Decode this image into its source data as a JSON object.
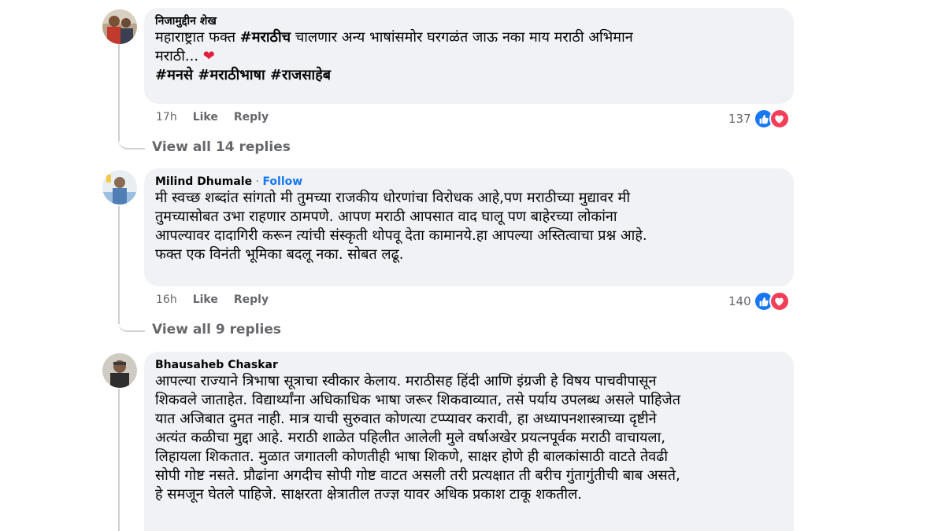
{
  "comments": [
    {
      "author": "निजामुद्दीन शेख",
      "follow": "",
      "text_lines": [
        [
          {
            "t": "महाराष्ट्रात फक्त ",
            "b": false
          },
          {
            "t": "#मराठीच",
            "b": true
          },
          {
            "t": " चालणार अन्य भाषांसमोर घरगळंत जाऊ नका माय मराठी अभिमान",
            "b": false
          }
        ],
        [
          {
            "t": "मराठी... ",
            "b": false
          }
        ],
        [
          {
            "t": "#मनसे #मराठीभाषा #राजसाहेब",
            "b": true
          }
        ]
      ],
      "heart_emoji": "❤",
      "time": "17h",
      "like_label": "Like",
      "reply_label": "Reply",
      "reaction_count": "137",
      "view_replies": "View all 14 replies"
    },
    {
      "author": "Milind Dhumale",
      "follow_sep": " · ",
      "follow": "Follow",
      "text_lines": [
        [
          {
            "t": "मी स्वच्छ शब्दांत सांगतो मी तुमच्या राजकीय धोरणांचा विरोधक आहे,पण मराठीच्या मुद्यावर मी",
            "b": false
          }
        ],
        [
          {
            "t": "तुमच्यासोबत उभा राहणार ठामपणे. आपण मराठी आपसात वाद घालू पण बाहेरच्या लोकांना",
            "b": false
          }
        ],
        [
          {
            "t": "आपल्यावर दादागिरी करून त्यांची संस्कृती थोपवू देता कामानये.हा आपल्या अस्तित्वाचा प्रश्न आहे.",
            "b": false
          }
        ],
        [
          {
            "t": "फक्त एक विनंती भूमिका बदलू नका. सोबत लढू.",
            "b": false
          }
        ]
      ],
      "time": "16h",
      "like_label": "Like",
      "reply_label": "Reply",
      "reaction_count": "140",
      "view_replies": "View all 9 replies"
    },
    {
      "author": "Bhausaheb Chaskar",
      "follow": "",
      "text_lines": [
        [
          {
            "t": "आपल्या राज्याने त्रिभाषा सूत्राचा स्वीकार केलाय. मराठीसह हिंदी आणि इंग्रजी हे विषय पाचवीपासून",
            "b": false
          }
        ],
        [
          {
            "t": "शिकवले जाताहेत. विद्यार्थ्यांना अधिकाधिक भाषा जरूर शिकवाव्यात, तसे पर्याय उपलब्ध असले पाहिजेत",
            "b": false
          }
        ],
        [
          {
            "t": "यात अजिबात दुमत नाही. मात्र याची सुरुवात कोणत्या टप्प्यावर करावी, हा अध्यापनशास्त्राच्या दृष्टीने",
            "b": false
          }
        ],
        [
          {
            "t": "अत्यंत कळीचा मुद्दा आहे. मराठी शाळेत पहिलीत आलेली मुले वर्षाअखेर प्रयत्नपूर्वक मराठी वाचायला,",
            "b": false
          }
        ],
        [
          {
            "t": "लिहायला शिकतात. मुळात जगातली कोणतीही भाषा शिकणे, साक्षर होणे ही बालकांसाठी वाटते तेवढी",
            "b": false
          }
        ],
        [
          {
            "t": "सोपी गोष्ट नसते. प्रौढांना अगदीच सोपी गोष्ट वाटत असली तरी प्रत्यक्षात ती बरीच गुंतागुंतीची बाब असते,",
            "b": false
          }
        ],
        [
          {
            "t": "हे समजून घेतले पाहिजे. साक्षरता क्षेत्रातील तज्ज्ञ यावर अधिक प्रकाश टाकू शकतील.",
            "b": false
          }
        ]
      ]
    }
  ],
  "colors": {
    "bubble": "#f0f2f5",
    "link": "#1877f2",
    "meta": "#65676b",
    "like_blue": "#1877f2",
    "love_red": "#f33e58"
  },
  "icons": [
    "like-reaction-icon",
    "love-reaction-icon",
    "heart-emoji-icon"
  ]
}
